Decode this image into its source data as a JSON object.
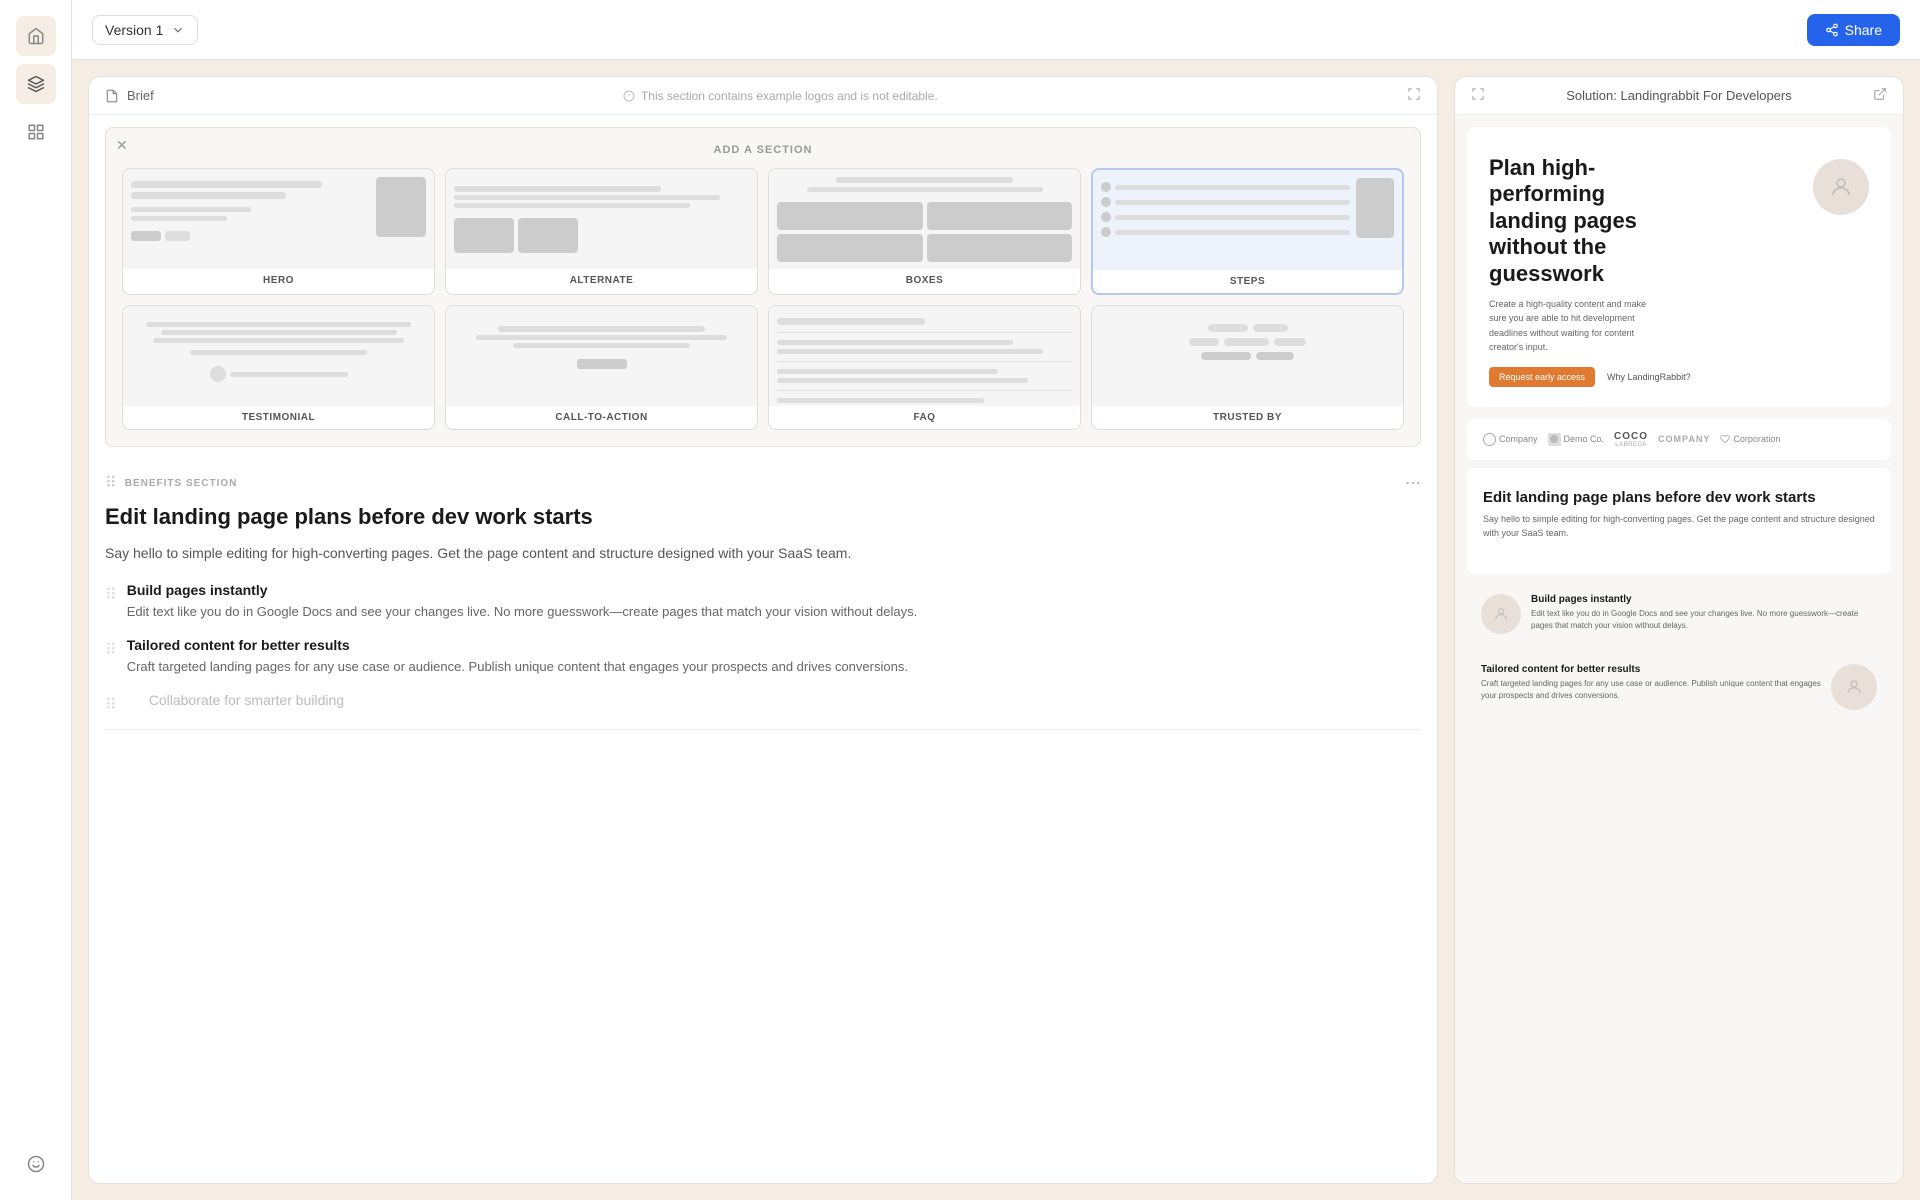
{
  "topbar": {
    "version_label": "Version 1",
    "share_label": "Share"
  },
  "brief_bar": {
    "brief_label": "Brief",
    "info_text": "This section contains example logos and is not editable."
  },
  "add_section": {
    "title": "ADD A SECTION",
    "sections": [
      {
        "id": "hero",
        "label": "HERO"
      },
      {
        "id": "alternate",
        "label": "ALTERNATE"
      },
      {
        "id": "boxes",
        "label": "BOXES"
      },
      {
        "id": "steps",
        "label": "STEPS"
      },
      {
        "id": "testimonial",
        "label": "TESTIMONIAL"
      },
      {
        "id": "call-to-action",
        "label": "CALL-TO-ACTION"
      },
      {
        "id": "faq",
        "label": "FAQ"
      },
      {
        "id": "trusted-by",
        "label": "TRUSTED BY"
      }
    ]
  },
  "editor": {
    "section_label": "BENEFITS SECTION",
    "title": "Edit landing page plans before dev work starts",
    "description": "Say hello to simple editing for high-converting pages. Get the page content and structure designed with your SaaS team.",
    "benefits": [
      {
        "title": "Build pages instantly",
        "desc": "Edit text like you do in Google Docs and see your changes live. No more guesswork—create pages that match your vision without delays."
      },
      {
        "title": "Tailored content for better results",
        "desc": "Craft targeted landing pages for any use case or audience. Publish unique content that engages your prospects and drives conversions."
      },
      {
        "title": "Collaborate for smarter building",
        "desc": ""
      }
    ]
  },
  "preview": {
    "title": "Solution: Landingrabbit For Developers",
    "hero": {
      "title": "Plan high-performing landing pages without the guesswork",
      "desc": "Create a high-quality content and make sure you are able to hit development deadlines without waiting for content creator's input.",
      "btn_primary": "Request early access",
      "btn_secondary": "Why LandingRabbit?"
    },
    "logos": [
      "Company",
      "Demo Co.",
      "COCO",
      "COMPANY",
      "Corporation"
    ],
    "benefits": {
      "title": "Edit landing page plans before dev work starts",
      "desc": "Say hello to simple editing for high-converting pages. Get the page content and structure designed with your SaaS team.",
      "items": [
        {
          "title": "Build pages instantly",
          "desc": "Edit text like you do in Google Docs and see your changes live. No more guesswork—create pages that match your vision without delays."
        },
        {
          "title": "Tailored content for better results",
          "desc": "Craft targeted landing pages for any use case or audience. Publish unique content that engages your prospects and drives conversions."
        }
      ]
    }
  },
  "sidebar": {
    "items": [
      {
        "id": "home",
        "icon": "⌂"
      },
      {
        "id": "layers",
        "icon": "◧"
      },
      {
        "id": "templates",
        "icon": "◫"
      }
    ],
    "bottom": [
      {
        "id": "emoji",
        "icon": "☺"
      }
    ]
  }
}
